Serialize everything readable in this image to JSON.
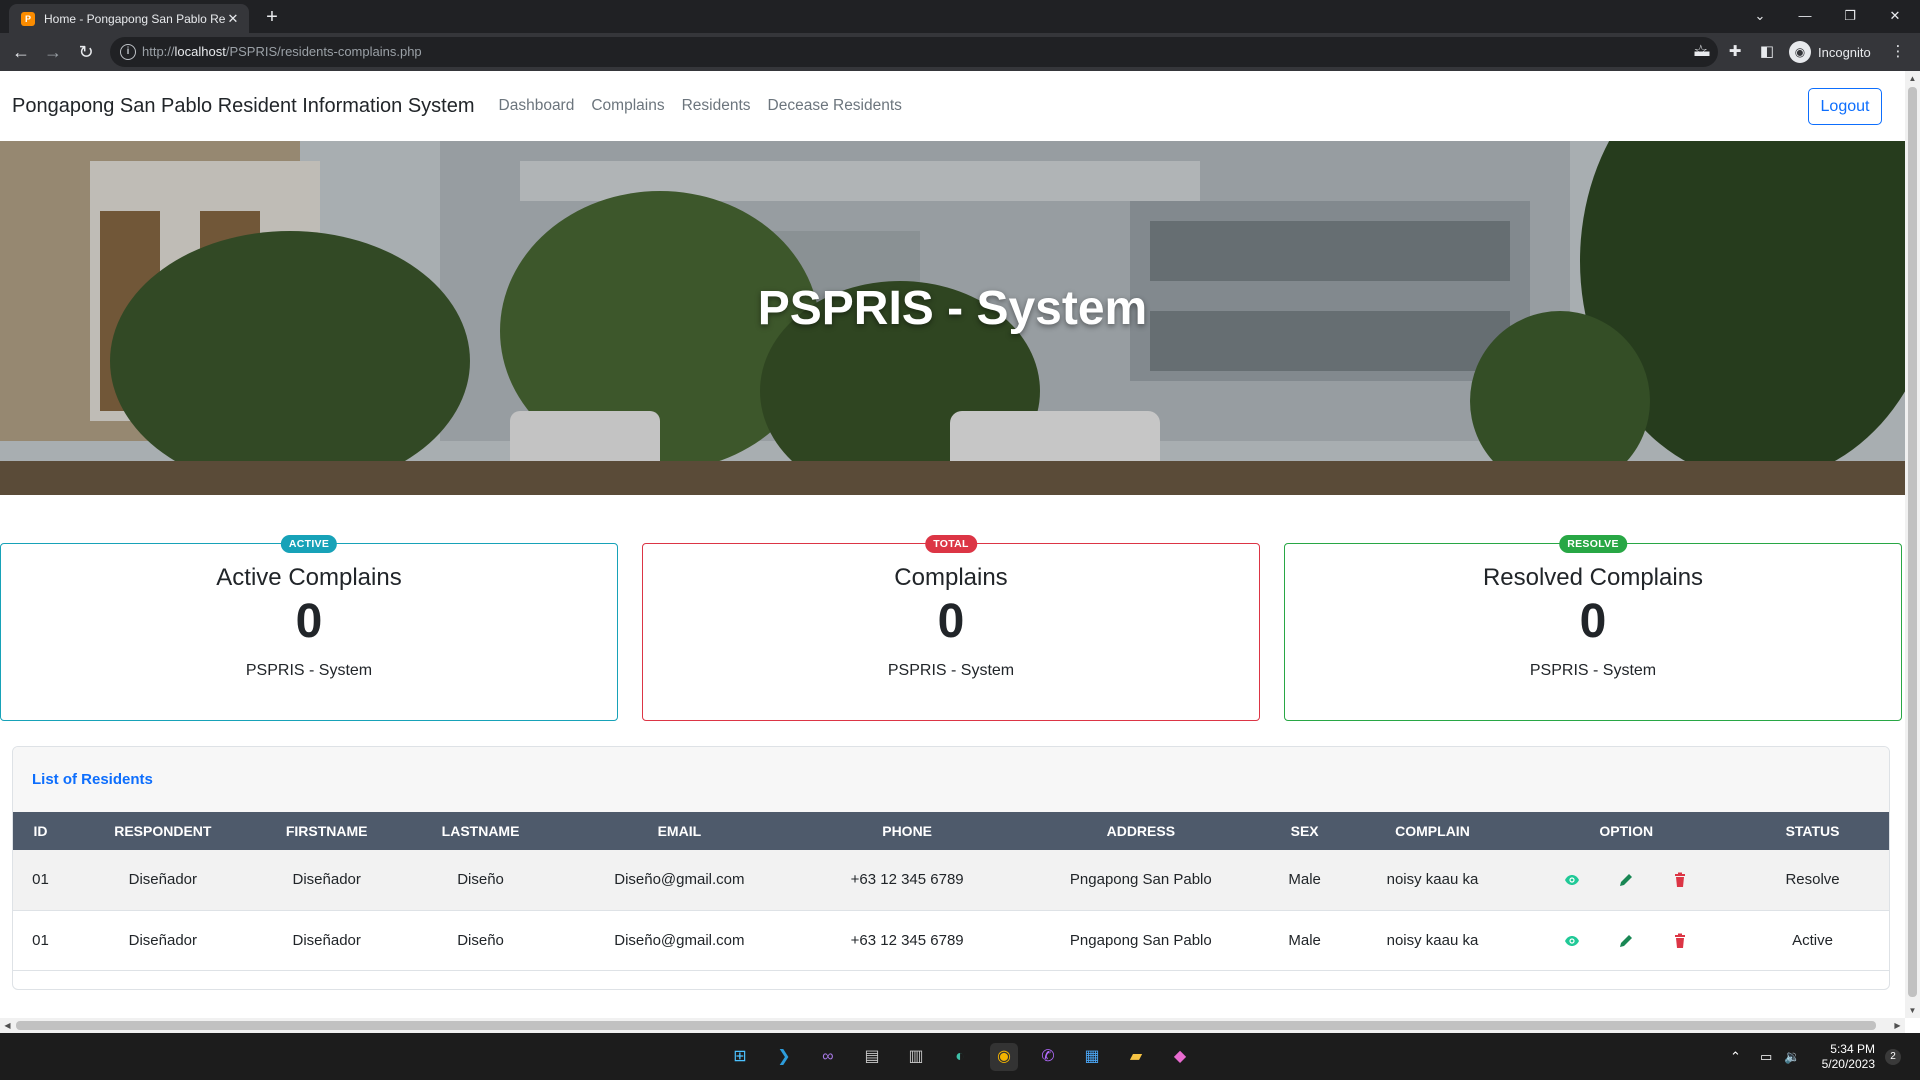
{
  "browser": {
    "tab_title": "Home - Pongapong San Pablo Re",
    "favicon_text": "P",
    "tab_close": "✕",
    "new_tab": "+",
    "url_prefix": "http://",
    "url_host": "localhost",
    "url_path": "/PSPRIS/residents-complains.php",
    "incognito_label": "Incognito"
  },
  "navbar": {
    "brand": "Pongapong San Pablo Resident Information System",
    "links": [
      "Dashboard",
      "Complains",
      "Residents",
      "Decease Residents"
    ],
    "logout_label": "Logout"
  },
  "hero": {
    "title": "PSPRIS - System"
  },
  "cards": [
    {
      "badge": "ACTIVE",
      "title": "Active Complains",
      "count": "0",
      "subtitle": "PSPRIS - System",
      "color": "#17a2b8"
    },
    {
      "badge": "TOTAL",
      "title": "Complains",
      "count": "0",
      "subtitle": "PSPRIS - System",
      "color": "#dc3545"
    },
    {
      "badge": "RESOLVE",
      "title": "Resolved Complains",
      "count": "0",
      "subtitle": "PSPRIS - System",
      "color": "#28a745"
    }
  ],
  "residents_table": {
    "heading": "List of Residents",
    "columns": [
      "ID",
      "RESPONDENT",
      "FIRSTNAME",
      "LASTNAME",
      "EMAIL",
      "PHONE",
      "ADDRESS",
      "SEX",
      "COMPLAIN",
      "OPTION",
      "STATUS"
    ],
    "rows": [
      {
        "id": "01",
        "respondent": "Diseñador",
        "firstname": "Diseñador",
        "lastname": "Diseño",
        "email": "Diseño@gmail.com",
        "phone": "+63 12 345 6789",
        "address": "Pngapong San Pablo",
        "sex": "Male",
        "complain": "noisy kaau ka",
        "status": "Resolve"
      },
      {
        "id": "01",
        "respondent": "Diseñador",
        "firstname": "Diseñador",
        "lastname": "Diseño",
        "email": "Diseño@gmail.com",
        "phone": "+63 12 345 6789",
        "address": "Pngapong San Pablo",
        "sex": "Male",
        "complain": "noisy kaau ka",
        "status": "Active"
      }
    ],
    "option_icons": [
      "eye-icon",
      "pencil-icon",
      "trash-icon"
    ]
  },
  "taskbar": {
    "time": "5:34 PM",
    "date": "5/20/2023",
    "notification_count": "2"
  },
  "colors": {
    "primary": "#0d6efd",
    "table_header": "#4e5a6b",
    "view": "#20c997",
    "edit": "#198754",
    "delete": "#dc3545"
  }
}
